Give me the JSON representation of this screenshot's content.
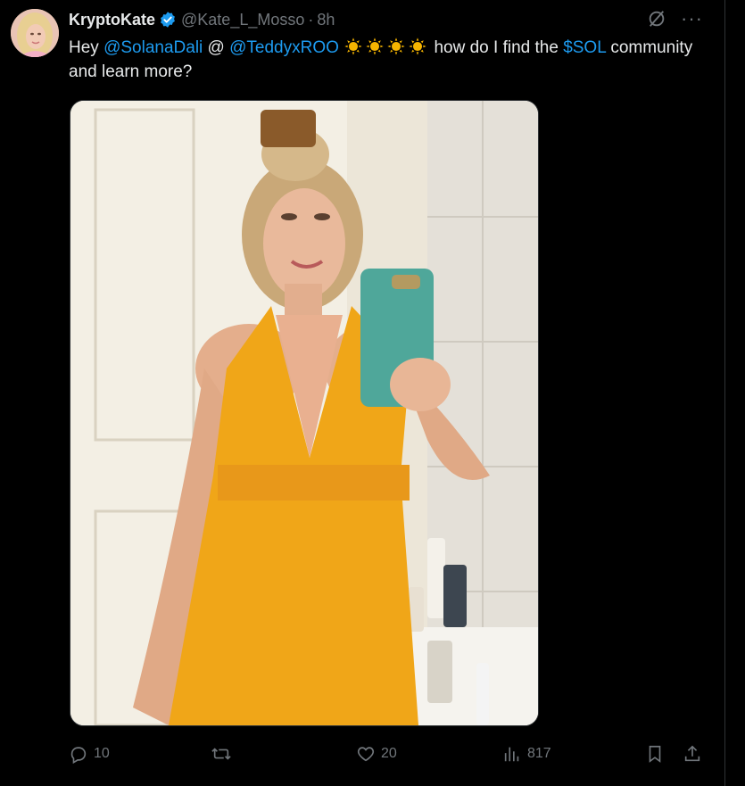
{
  "author": {
    "name": "KryptoKate",
    "handle": "@Kate_L_Mosso",
    "separator": "·",
    "time": "8h"
  },
  "tweet": {
    "segments": [
      {
        "text": "Hey ",
        "type": "plain"
      },
      {
        "text": "@SolanaDali",
        "type": "link"
      },
      {
        "text": " @ ",
        "type": "plain"
      },
      {
        "text": "@TeddyxROO",
        "type": "link"
      },
      {
        "text": " ",
        "type": "plain"
      },
      {
        "text": "",
        "type": "emoji-sun"
      },
      {
        "text": "",
        "type": "emoji-sun"
      },
      {
        "text": "",
        "type": "emoji-sun"
      },
      {
        "text": "",
        "type": "emoji-sun"
      },
      {
        "text": " how do I find the ",
        "type": "plain"
      },
      {
        "text": "$SOL",
        "type": "link"
      },
      {
        "text": " community and learn more?",
        "type": "plain"
      }
    ]
  },
  "icons": {
    "verified": "verified-badge-icon",
    "grok": "grok-icon",
    "more": "more-icon",
    "reply": "reply-icon",
    "repost": "repost-icon",
    "like": "like-icon",
    "views": "views-icon",
    "bookmark": "bookmark-icon",
    "share": "share-icon"
  },
  "actions": {
    "replies": "10",
    "reposts": "",
    "likes": "20",
    "views": "817"
  },
  "colors": {
    "background": "#000000",
    "link": "#1d9bf0",
    "muted": "#71767b",
    "verified": "#1d9bf0",
    "dress": "#f0a618"
  }
}
